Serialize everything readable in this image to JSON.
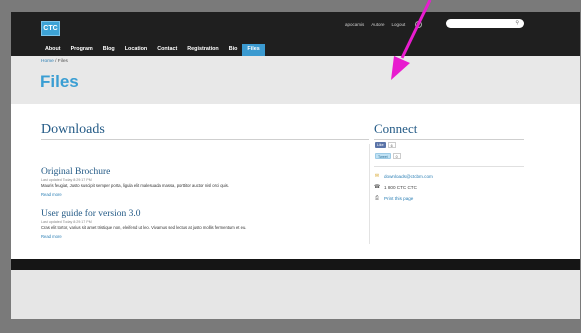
{
  "logo": {
    "text": "CTC"
  },
  "util_nav": [
    "apocamis",
    "Autore",
    "Logout"
  ],
  "main_nav": [
    {
      "label": "About",
      "active": false
    },
    {
      "label": "Program",
      "active": false
    },
    {
      "label": "Blog",
      "active": false
    },
    {
      "label": "Location",
      "active": false
    },
    {
      "label": "Contact",
      "active": false
    },
    {
      "label": "Registration",
      "active": false
    },
    {
      "label": "Bio",
      "active": false
    },
    {
      "label": "Files",
      "active": true
    }
  ],
  "breadcrumb": {
    "home": "Home",
    "sep": " / ",
    "current": "Files"
  },
  "page_title": "Files",
  "downloads": {
    "title": "Downloads",
    "items": [
      {
        "title": "Original Brochure",
        "meta": "Last updated Today 8:29:17 PM",
        "body": "Mauris feugiat, Justo suscipit semper porta, ligula elit malesuada massa, porttitor auctor nisl orci quis.",
        "more": "Read more"
      },
      {
        "title": "User guide for version 3.0",
        "meta": "Last updated Today 8:29:17 PM",
        "body": "Cras elit tortor, varius sit amet tristique non, eleifend ut leo. Vivamus sed lectus at justo mollis fermentum et eu.",
        "more": "Read more"
      }
    ]
  },
  "connect": {
    "title": "Connect",
    "like_label": "Like",
    "like_count": "6",
    "tweet_label": "Tweet",
    "tweet_count": "0",
    "email": "downloads@ctcbm.com",
    "phone": "1 800 CTC CTC",
    "print": "Print this page"
  },
  "colors": {
    "accent": "#3b9ad0",
    "heading": "#235a86",
    "arrow": "#e81ccf"
  }
}
